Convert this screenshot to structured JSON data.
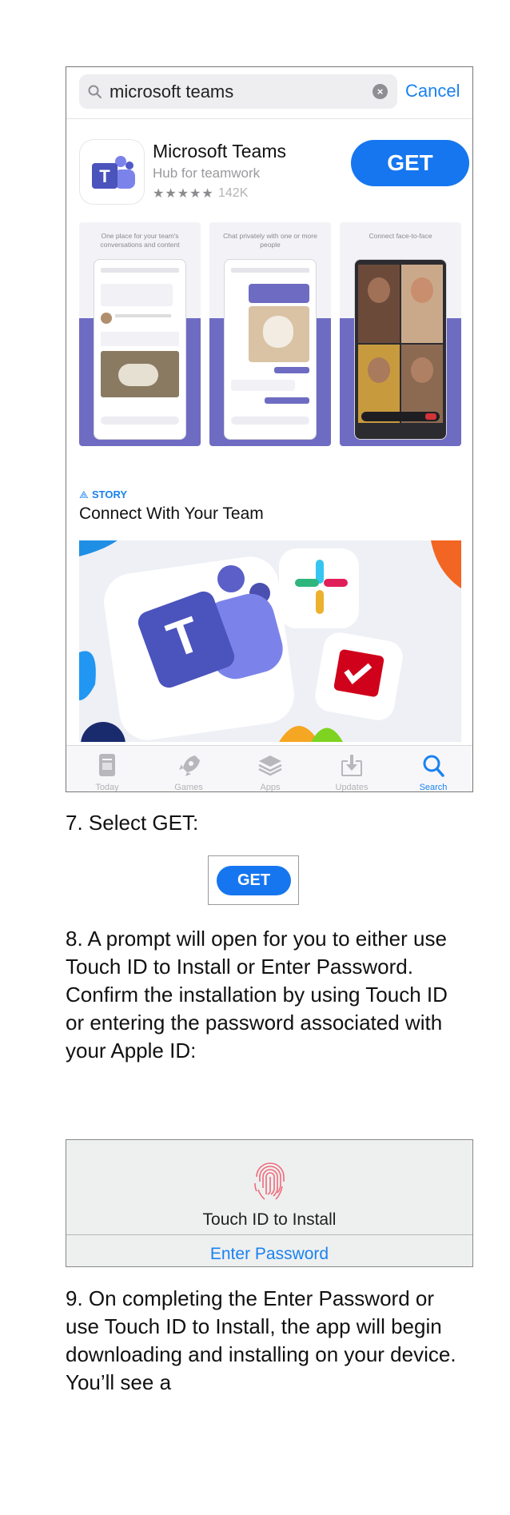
{
  "store": {
    "search_query": "microsoft teams",
    "cancel_label": "Cancel",
    "app_name": "Microsoft Teams",
    "app_subtitle": "Hub for teamwork",
    "rating_stars": "★★★★★",
    "rating_count": "142K",
    "get_label": "GET",
    "screenshots": [
      {
        "caption": "One place for your team's conversations and content"
      },
      {
        "caption": "Chat privately with one or more people"
      },
      {
        "caption": "Connect face-to-face"
      }
    ],
    "story_tag": "STORY",
    "story_title": "Connect With Your Team",
    "tabs": [
      {
        "label": "Today",
        "icon": "today-icon"
      },
      {
        "label": "Games",
        "icon": "rocket-icon"
      },
      {
        "label": "Apps",
        "icon": "layers-icon"
      },
      {
        "label": "Updates",
        "icon": "download-tray-icon"
      },
      {
        "label": "Search",
        "icon": "search-icon",
        "active": true
      }
    ],
    "colors": {
      "accent": "#1676f0",
      "teams_purple": "#5b5fc7",
      "band": "#6e6cc2"
    }
  },
  "doc": {
    "step7": "7.   Select GET:",
    "get_small_label": "GET",
    "step8": "8.   A prompt will open for you to either use Touch ID to Install or Enter Password. Confirm the installation by using Touch ID or entering the password associated with your Apple ID:",
    "touch_id_label": "Touch ID to Install",
    "enter_password_label": "Enter Password",
    "step9": "9.   On completing the Enter Password or use Touch ID to Install, the app will begin downloading and installing on your device. You’ll see a"
  }
}
